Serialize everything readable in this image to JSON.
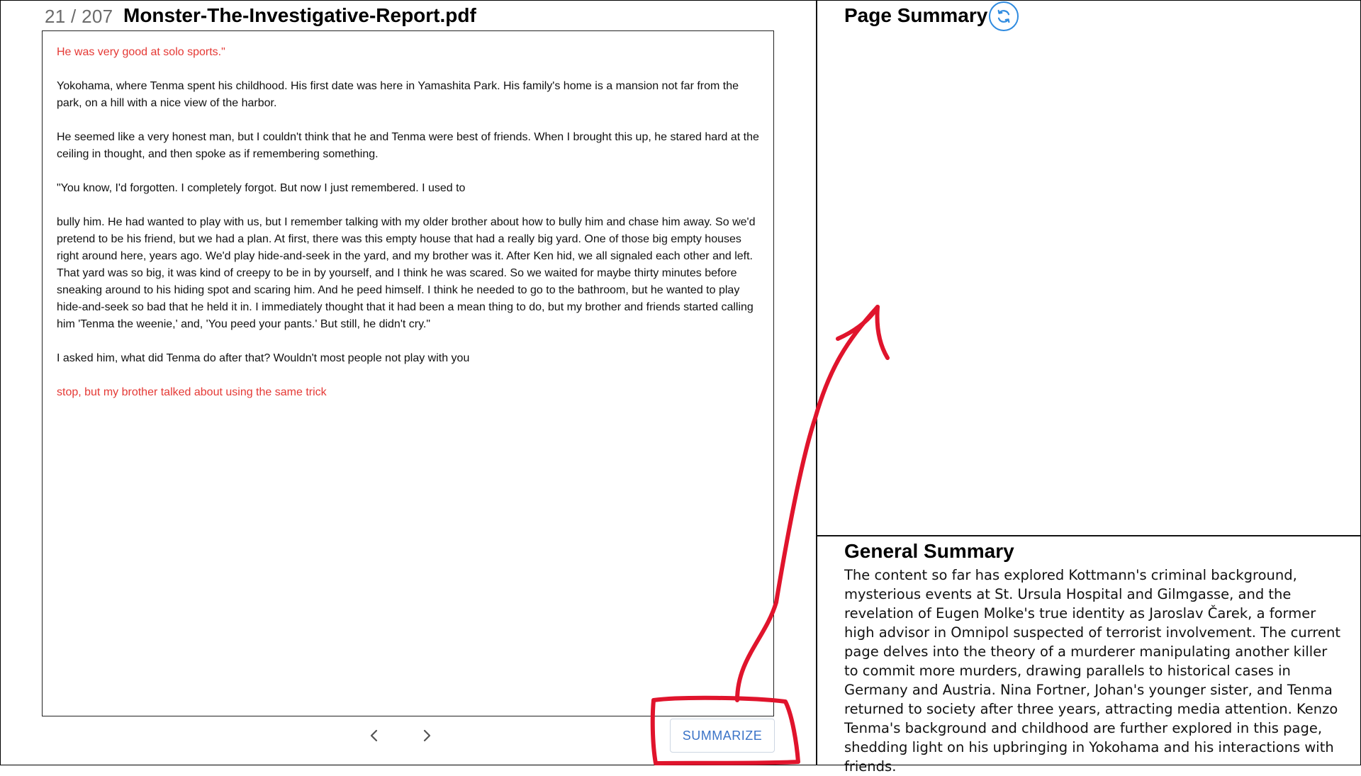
{
  "header": {
    "page_counter": "21 / 207",
    "doc_title": "Monster-The-Investigative-Report.pdf"
  },
  "pdf": {
    "paragraphs": [
      {
        "text": "He was very good at solo sports.\"",
        "color": "red"
      },
      {
        "text": "Yokohama, where Tenma spent his childhood. His first date was here in Yamashita Park. His family's home is a mansion not far from the park, on a hill with a nice view of the harbor.",
        "color": "black"
      },
      {
        "text": "He seemed like a very honest man, but I couldn't think that he and Tenma were best of friends. When I brought this up, he stared hard at the ceiling in thought, and then spoke as if remembering something.",
        "color": "black"
      },
      {
        "text": "\"You know, I'd forgotten. I completely forgot. But now I just remembered. I used to",
        "color": "black"
      },
      {
        "text": "bully him. He had wanted to play with us, but I remember talking with my older brother about how to bully him and chase him away. So we'd pretend to be his friend, but we had a plan. At first, there was this empty house that had a really big yard. One of those big empty houses right around here, years ago. We'd play hide-and-seek in the yard, and my brother was it. After Ken hid, we all signaled each other and left. That yard was so big, it was kind of creepy to be in by yourself, and I think he was scared. So we waited for maybe thirty minutes before sneaking around to his hiding spot and scaring him. And he peed himself. I think he needed to go to the bathroom, but he wanted to play hide-and-seek so bad that he held it in. I immediately thought that it had been a mean thing to do, but my brother and friends started calling him 'Tenma the weenie,' and, 'You peed your pants.' But still, he didn't cry.\"",
        "color": "black"
      },
      {
        "text": "I asked him, what did Tenma do after that? Wouldn't most people not play with you",
        "color": "black"
      },
      {
        "text": "stop, but my brother talked about using the same trick",
        "color": "red"
      }
    ]
  },
  "controls": {
    "prev_icon": "chevron-left-icon",
    "next_icon": "chevron-right-icon",
    "summarize_label": "SUMMARIZE",
    "refresh_icon": "refresh-icon"
  },
  "right_panel": {
    "page_summary_title": "Page Summary",
    "page_summary_text": "",
    "general_summary_title": "General Summary",
    "general_summary_text": "The content so far has explored Kottmann's criminal background, mysterious events at St. Ursula Hospital and Gilmgasse, and the revelation of Eugen Molke's true identity as Jaroslav Čarek, a former high advisor in Omnipol suspected of terrorist involvement. The current page delves into the theory of a murderer manipulating another killer to commit more murders, drawing parallels to historical cases in Germany and Austria. Nina Fortner, Johan's younger sister, and Tenma returned to society after three years, attracting media attention. Kenzo Tenma's background and childhood are further explored in this page, shedding light on his upbringing in Yokohama and his interactions with friends."
  },
  "colors": {
    "red_text": "#e53935",
    "accent_blue": "#3a73c7",
    "refresh_blue": "#2f8be0",
    "annotation_red": "#e0142c"
  }
}
